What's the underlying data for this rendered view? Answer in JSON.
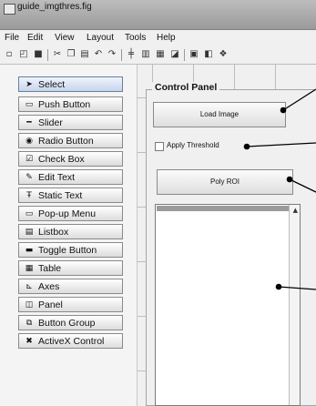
{
  "window": {
    "title": "guide_imgthres.fig"
  },
  "menu": [
    "File",
    "Edit",
    "View",
    "Layout",
    "Tools",
    "Help"
  ],
  "toolbar_icons": [
    "new-icon",
    "open-icon",
    "save-icon",
    "cut-icon",
    "copy-icon",
    "paste-icon",
    "undo-icon",
    "redo-icon",
    "align-icon",
    "menu-editor-icon",
    "tab-order-icon",
    "toolbar-editor-icon",
    "mfile-editor-icon",
    "property-inspector-icon",
    "object-browser-icon"
  ],
  "palette": {
    "items": [
      {
        "label": "Select",
        "icon": "arrow-icon"
      },
      {
        "label": "Push Button",
        "icon": "push-button-icon"
      },
      {
        "label": "Slider",
        "icon": "slider-icon"
      },
      {
        "label": "Radio Button",
        "icon": "radio-button-icon"
      },
      {
        "label": "Check Box",
        "icon": "check-box-icon"
      },
      {
        "label": "Edit Text",
        "icon": "edit-text-icon"
      },
      {
        "label": "Static Text",
        "icon": "static-text-icon"
      },
      {
        "label": "Pop-up Menu",
        "icon": "popup-menu-icon"
      },
      {
        "label": "Listbox",
        "icon": "listbox-icon"
      },
      {
        "label": "Toggle Button",
        "icon": "toggle-button-icon"
      },
      {
        "label": "Table",
        "icon": "table-icon"
      },
      {
        "label": "Axes",
        "icon": "axes-icon"
      },
      {
        "label": "Panel",
        "icon": "panel-icon"
      },
      {
        "label": "Button Group",
        "icon": "button-group-icon"
      },
      {
        "label": "ActiveX Control",
        "icon": "activex-icon"
      }
    ]
  },
  "layout": {
    "panel_title": "Control Panel",
    "load_button": "Load Image",
    "threshold_checkbox": "Apply Threshold",
    "roi_button": "Poly ROI"
  },
  "colors": {
    "accent": "#000000"
  }
}
